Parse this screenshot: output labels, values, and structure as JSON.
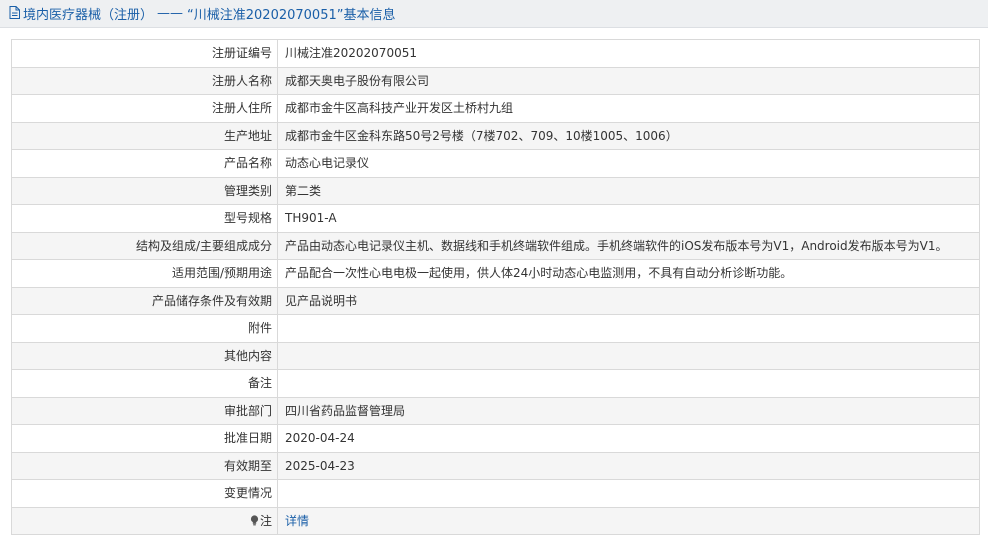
{
  "header": {
    "category": "境内医疗器械（注册）",
    "separator": "——",
    "title": "“川械注准20202070051”基本信息",
    "icon": "document-icon"
  },
  "rows": [
    {
      "label": "注册证编号",
      "value": "川械注准20202070051"
    },
    {
      "label": "注册人名称",
      "value": "成都天奥电子股份有限公司"
    },
    {
      "label": "注册人住所",
      "value": "成都市金牛区高科技产业开发区土桥村九组"
    },
    {
      "label": "生产地址",
      "value": "成都市金牛区金科东路50号2号楼（7楼702、709、10楼1005、1006）"
    },
    {
      "label": "产品名称",
      "value": "动态心电记录仪"
    },
    {
      "label": "管理类别",
      "value": "第二类"
    },
    {
      "label": "型号规格",
      "value": "TH901-A"
    },
    {
      "label": "结构及组成/主要组成成分",
      "value": "产品由动态心电记录仪主机、数据线和手机终端软件组成。手机终端软件的iOS发布版本号为V1，Android发布版本号为V1。"
    },
    {
      "label": "适用范围/预期用途",
      "value": "产品配合一次性心电电极一起使用，供人体24小时动态心电监测用，不具有自动分析诊断功能。"
    },
    {
      "label": "产品储存条件及有效期",
      "value": "见产品说明书"
    },
    {
      "label": "附件",
      "value": ""
    },
    {
      "label": "其他内容",
      "value": ""
    },
    {
      "label": "备注",
      "value": ""
    },
    {
      "label": "审批部门",
      "value": "四川省药品监督管理局"
    },
    {
      "label": "批准日期",
      "value": "2020-04-24"
    },
    {
      "label": "有效期至",
      "value": "2025-04-23"
    },
    {
      "label": "变更情况",
      "value": ""
    }
  ],
  "note_row": {
    "icon": "lightbulb-icon",
    "label": "注",
    "link_text": "详情"
  },
  "colors": {
    "accent": "#1a5fa8",
    "header_bg": "#eef0f2",
    "border": "#d9d9d9",
    "row_alt": "#f5f5f5"
  }
}
